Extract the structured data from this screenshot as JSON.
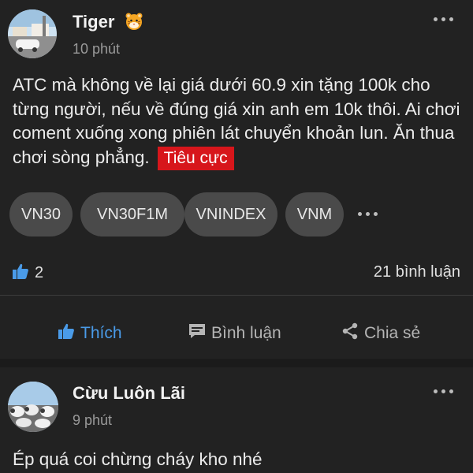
{
  "posts": [
    {
      "author": "Tiger",
      "author_badge": "tiger-emoji",
      "time": "10 phút",
      "content": "ATC mà không về lại giá dưới 60.9 xin tặng 100k cho từng người, nếu về đúng giá xin anh em 10k thôi. Ai chơi coment xuống xong phiên lát chuyển khoản lun. Ăn thua chơi sòng phẳng.",
      "sentiment_label": "Tiêu cực",
      "tags": [
        "VN30",
        "VN30F1M",
        "VNINDEX",
        "VNM"
      ],
      "like_count": "2",
      "comment_count": "21 bình luận",
      "actions": {
        "like": "Thích",
        "comment": "Bình luận",
        "share": "Chia sẻ"
      }
    },
    {
      "author": "Cừu Luôn Lãi",
      "time": "9 phút",
      "content": "Ép quá coi chừng cháy kho nhé"
    }
  ],
  "colors": {
    "background": "#1b1b1b",
    "card": "#222222",
    "accent_blue": "#4a9be8",
    "sentiment_red": "#d7161b",
    "tag_bg": "#4a4a4a",
    "muted": "#9a9a9a"
  },
  "icons": [
    "tiger-emoji",
    "more-icon",
    "thumbs-up-icon",
    "comment-icon",
    "share-icon"
  ]
}
